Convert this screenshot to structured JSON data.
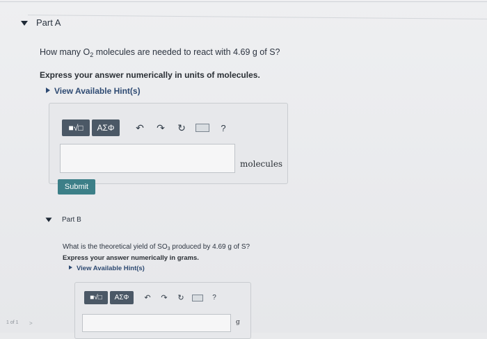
{
  "part_a": {
    "title": "Part A",
    "question_pre": "How many O",
    "question_sub": "2",
    "question_post": " molecules are needed to react with 4.69 g of S?",
    "instruction": "Express your answer numerically in units of molecules.",
    "hint": "View Available Hint(s)",
    "toolbar": {
      "greek": "ΑΣΦ",
      "help": "?"
    },
    "unit": "molecules",
    "submit": "Submit"
  },
  "part_b": {
    "title": "Part B",
    "question_pre": "What is the theoretical yield of SO",
    "question_sub": "3",
    "question_post": " produced by 4.69 g of S?",
    "instruction": "Express your answer numerically in grams.",
    "hint": "View Available Hint(s)",
    "toolbar": {
      "greek": "ΑΣΦ",
      "help": "?"
    },
    "unit": "g"
  },
  "pager": {
    "label": "1 of 1",
    "arrow": ">"
  }
}
